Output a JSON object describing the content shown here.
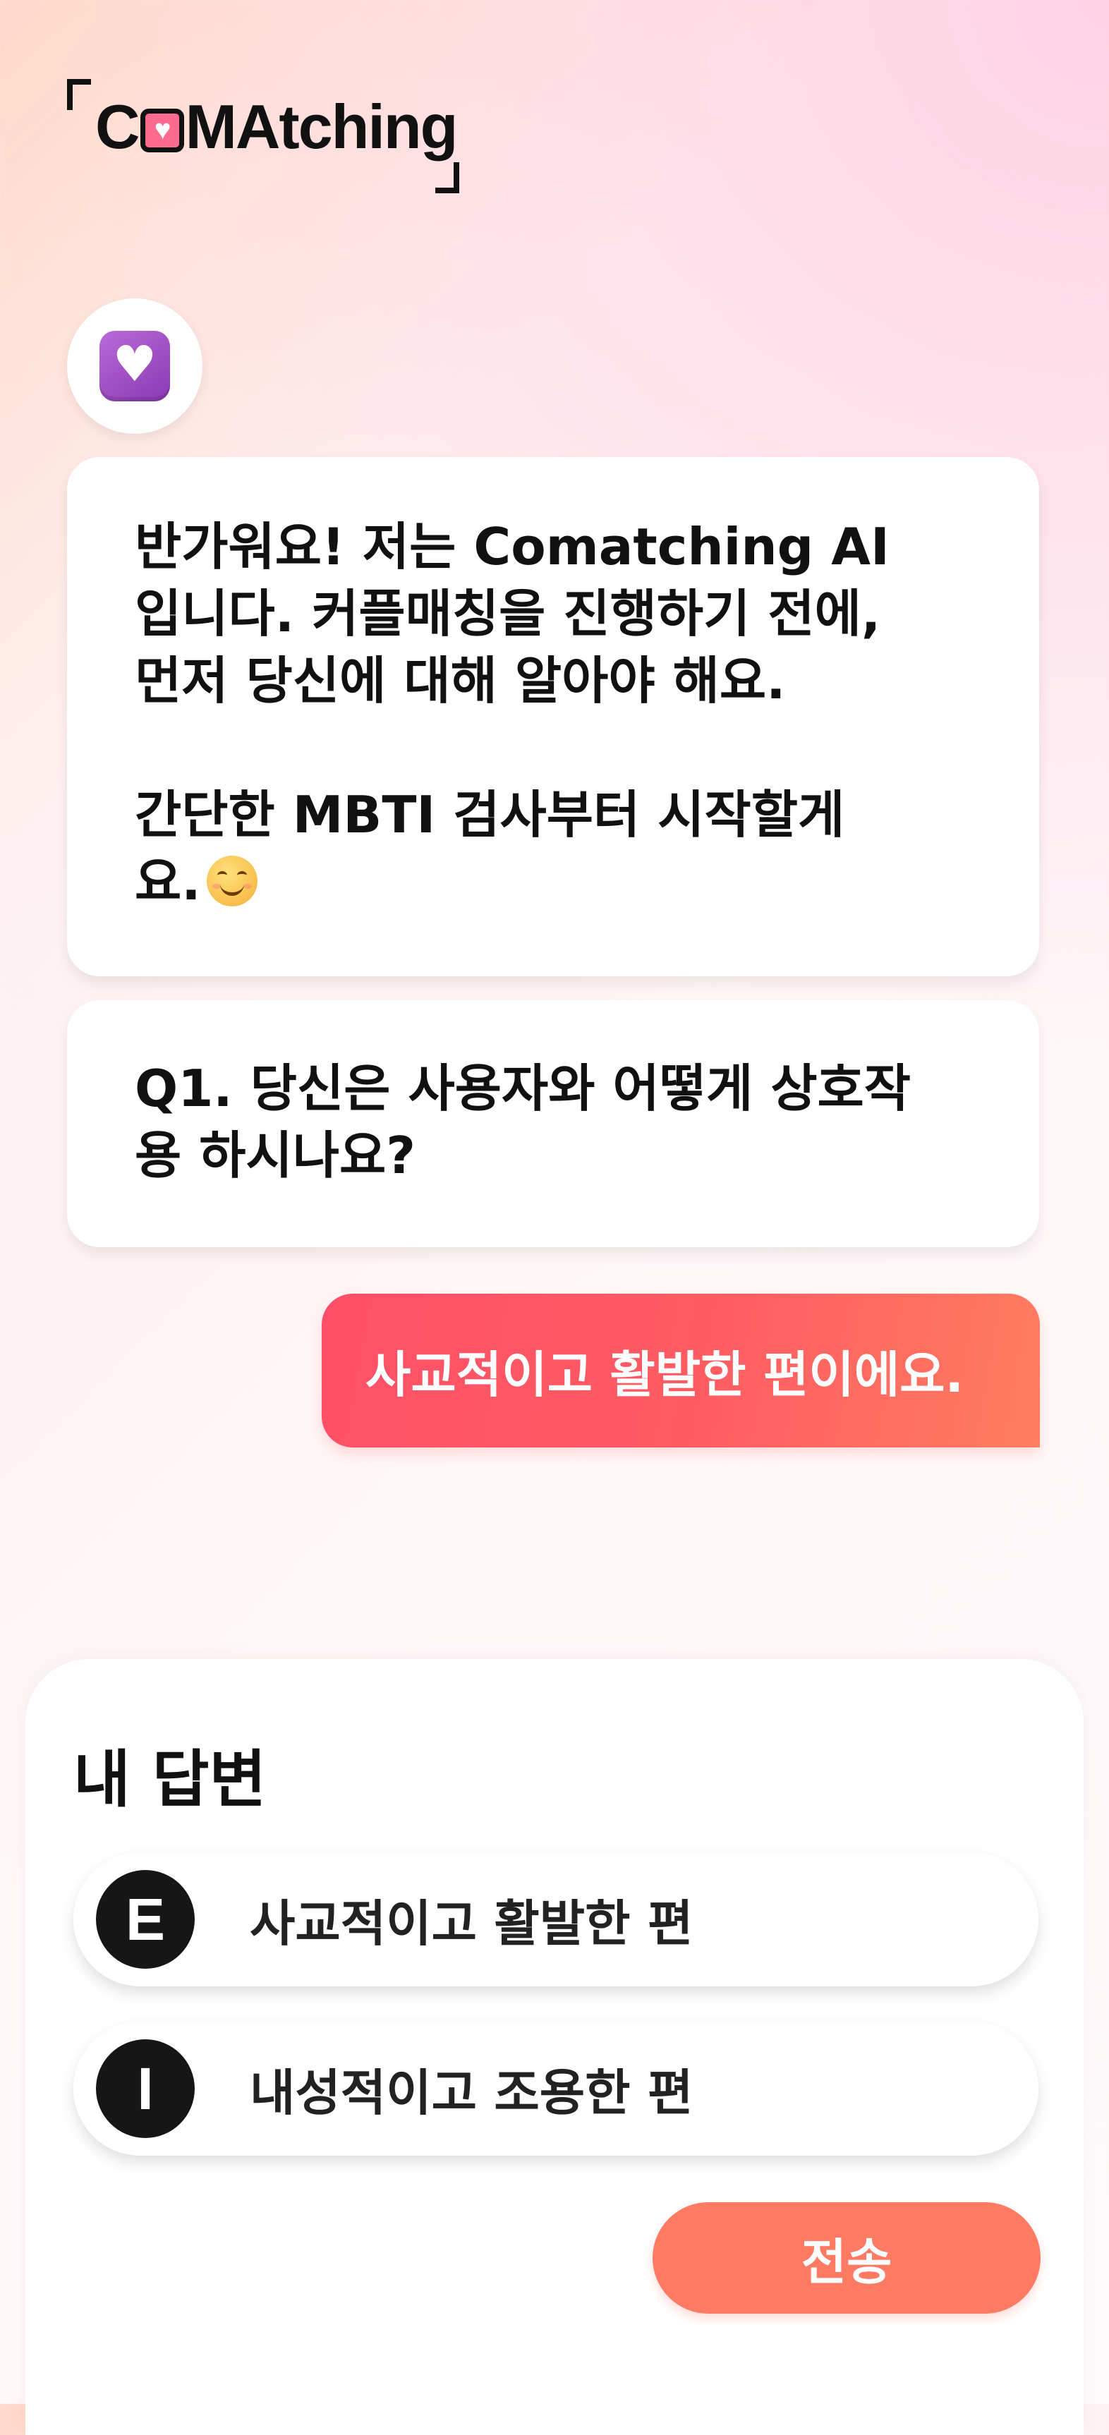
{
  "header": {
    "logo_prefix": "C",
    "logo_suffix": "MAtching"
  },
  "chat": {
    "bot_messages": [
      {
        "lines": [
          "반가워요! 저는 Comatching AI",
          "입니다. 커플매칭을 진행하기 전에,",
          "먼저 당신에 대해 알아야 해요.",
          "",
          "간단한 MBTI 검사부터 시작할게",
          "요."
        ],
        "emoji": "smiling-face-emoji"
      },
      {
        "lines": [
          "Q1. 당신은 사용자와 어떻게 상호작",
          "용 하시나요?"
        ]
      }
    ],
    "user_message": "사교적이고 활발한 편이에요."
  },
  "answer_panel": {
    "title": "내 답변",
    "options": [
      {
        "badge": "E",
        "label": "사교적이고 활발한 편"
      },
      {
        "badge": "I",
        "label": "내성적이고 조용한 편"
      }
    ],
    "send_label": "전송"
  },
  "colors": {
    "accent": "#ff5d62",
    "send_button": "#ff7a63",
    "badge_bg": "#161616",
    "avatar_heart": "#9b46c2"
  },
  "icons": {
    "logo_heart": "heart-icon",
    "avatar": "purple-heart-icon"
  }
}
